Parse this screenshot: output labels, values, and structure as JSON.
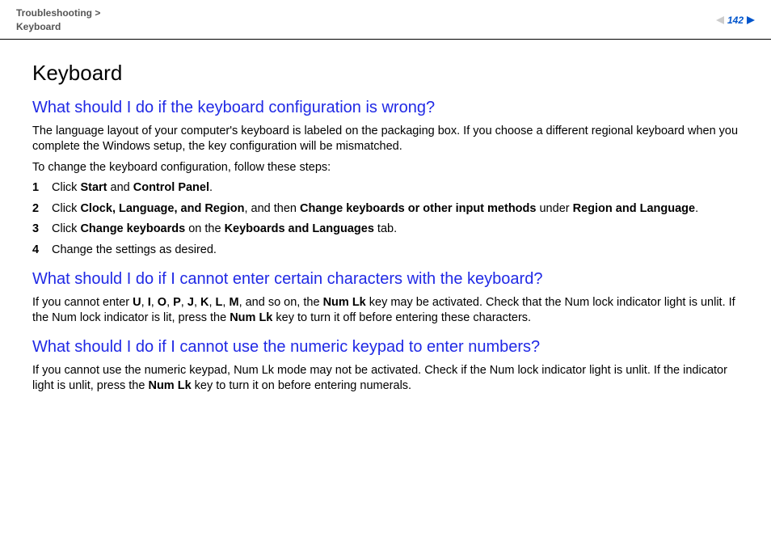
{
  "header": {
    "breadcrumb_parent": "Troubleshooting",
    "breadcrumb_sep": " > ",
    "breadcrumb_current": "Keyboard",
    "page_number": "142"
  },
  "page": {
    "title": "Keyboard",
    "sections": [
      {
        "heading": "What should I do if the keyboard configuration is wrong?",
        "para1": "The language layout of your computer's keyboard is labeled on the packaging box. If you choose a different regional keyboard when you complete the Windows setup, the key configuration will be mismatched.",
        "para2": "To change the keyboard configuration, follow these steps:",
        "steps": [
          {
            "n": "1",
            "pre": "Click ",
            "b1": "Start",
            "mid": " and ",
            "b2": "Control Panel",
            "post": "."
          },
          {
            "n": "2",
            "pre": "Click ",
            "b1": "Clock, Language, and Region",
            "mid": ", and then ",
            "b2": "Change keyboards or other input methods",
            "mid2": " under ",
            "b3": "Region and Language",
            "post": "."
          },
          {
            "n": "3",
            "pre": "Click ",
            "b1": "Change keyboards",
            "mid": " on the ",
            "b2": "Keyboards and Languages",
            "post": " tab."
          },
          {
            "n": "4",
            "text": "Change the settings as desired."
          }
        ]
      },
      {
        "heading": "What should I do if I cannot enter certain characters with the keyboard?",
        "rich": {
          "pre": "If you cannot enter ",
          "letters": [
            "U",
            "I",
            "O",
            "P",
            "J",
            "K",
            "L",
            "M"
          ],
          "after_letters": ", and so on, the ",
          "k1": "Num Lk",
          "mid": " key may be activated. Check that the Num lock indicator light is unlit. If the Num lock indicator is lit, press the ",
          "k2": "Num Lk",
          "post": " key to turn it off before entering these characters."
        }
      },
      {
        "heading": "What should I do if I cannot use the numeric keypad to enter numbers?",
        "rich2": {
          "pre": "If you cannot use the numeric keypad, Num Lk mode may not be activated. Check if the Num lock indicator light is unlit. If the indicator light is unlit, press the ",
          "k1": "Num Lk",
          "post": " key to turn it on before entering numerals."
        }
      }
    ]
  }
}
